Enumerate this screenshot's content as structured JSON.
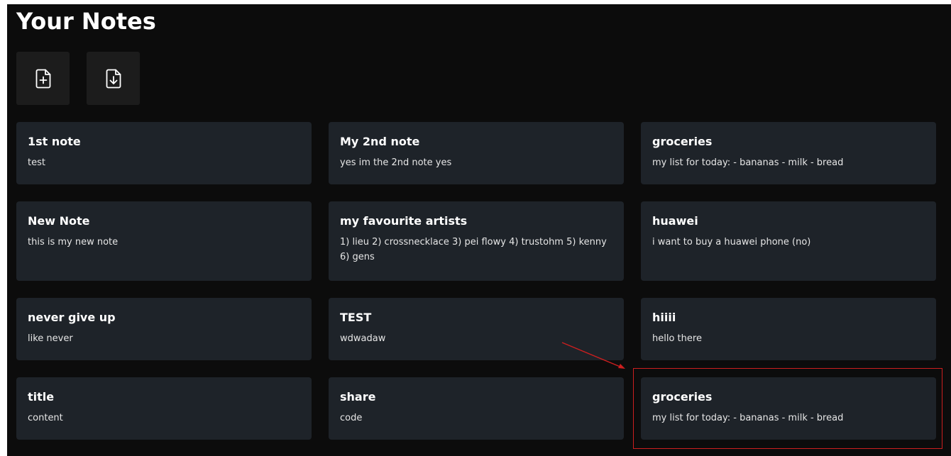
{
  "page": {
    "title": "Your Notes"
  },
  "toolbar": {
    "new_note_icon": "file-plus-icon",
    "import_icon": "file-download-icon"
  },
  "notes": [
    {
      "title": "1st note",
      "content": "test"
    },
    {
      "title": "My 2nd note",
      "content": "yes im the 2nd note yes"
    },
    {
      "title": "groceries",
      "content": "my list for today: - bananas - milk - bread"
    },
    {
      "title": "New Note",
      "content": "this is my new note"
    },
    {
      "title": "my favourite artists",
      "content": "1) lieu 2) crossnecklace 3) pei flowy 4) trustohm 5) kenny 6) gens"
    },
    {
      "title": "huawei",
      "content": "i want to buy a huawei phone (no)"
    },
    {
      "title": "never give up",
      "content": "like never"
    },
    {
      "title": "TEST",
      "content": "wdwadaw"
    },
    {
      "title": "hiiii",
      "content": "hello there"
    },
    {
      "title": "title",
      "content": "content"
    },
    {
      "title": "share",
      "content": "code"
    },
    {
      "title": "groceries",
      "content": "my list for today: - bananas - milk - bread"
    }
  ],
  "colors": {
    "background": "#0c0c0c",
    "card": "#1e2329",
    "button": "#1c1c1c",
    "annotation": "#cc1f1f"
  }
}
